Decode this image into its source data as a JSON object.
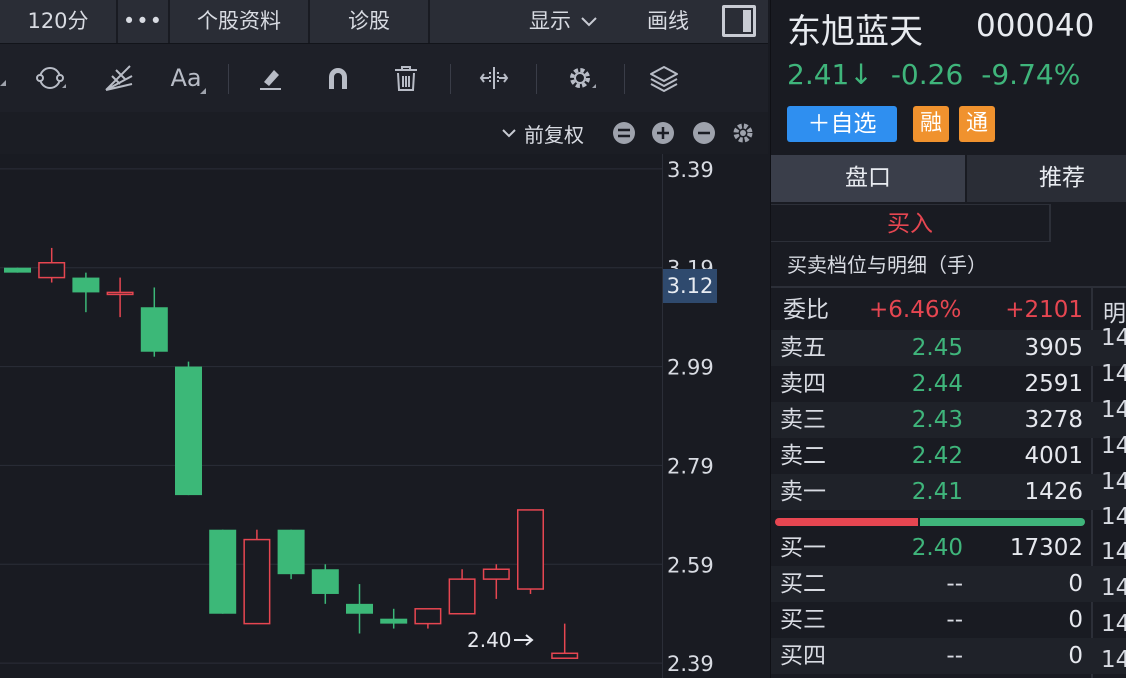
{
  "topbar": {
    "period": "120分",
    "more": "•••",
    "profile": "个股资料",
    "diagnose": "诊股",
    "display": "显示",
    "draw": "画线"
  },
  "toolbar": {
    "tools": [
      "cycle-tool",
      "fan-tool",
      "text-tool",
      "eraser-tool",
      "magnet-tool",
      "delete-tool",
      "range-tool",
      "settings-tool",
      "layers-tool"
    ],
    "text_tool_label": "Aa"
  },
  "chart_header": {
    "adjust": "前复权"
  },
  "chart": {
    "y_ticks": [
      "3.39",
      "3.19",
      "2.99",
      "2.79",
      "2.59",
      "2.39"
    ],
    "current_price_tag": "3.12",
    "low_label": "2.40",
    "colors": {
      "up": "#e64651",
      "down": "#3cb878",
      "grid": "#2b2e38",
      "tag": "#2f4a6e"
    }
  },
  "chart_data": {
    "type": "candlestick",
    "ylim": [
      2.36,
      3.42
    ],
    "candles": [
      {
        "open": 3.19,
        "close": 3.18,
        "high": 3.19,
        "low": 3.18
      },
      {
        "open": 3.17,
        "close": 3.2,
        "high": 3.23,
        "low": 3.16
      },
      {
        "open": 3.17,
        "close": 3.14,
        "high": 3.18,
        "low": 3.1
      },
      {
        "open": 3.14,
        "close": 3.14,
        "high": 3.17,
        "low": 3.09
      },
      {
        "open": 3.11,
        "close": 3.02,
        "high": 3.15,
        "low": 3.01
      },
      {
        "open": 2.99,
        "close": 2.73,
        "high": 3.0,
        "low": 2.73
      },
      {
        "open": 2.66,
        "close": 2.49,
        "high": 2.66,
        "low": 2.49
      },
      {
        "open": 2.47,
        "close": 2.64,
        "high": 2.66,
        "low": 2.47
      },
      {
        "open": 2.66,
        "close": 2.57,
        "high": 2.66,
        "low": 2.56
      },
      {
        "open": 2.58,
        "close": 2.53,
        "high": 2.59,
        "low": 2.51
      },
      {
        "open": 2.51,
        "close": 2.49,
        "high": 2.55,
        "low": 2.45
      },
      {
        "open": 2.48,
        "close": 2.47,
        "high": 2.5,
        "low": 2.46
      },
      {
        "open": 2.47,
        "close": 2.5,
        "high": 2.5,
        "low": 2.46
      },
      {
        "open": 2.49,
        "close": 2.56,
        "high": 2.58,
        "low": 2.49
      },
      {
        "open": 2.56,
        "close": 2.58,
        "high": 2.59,
        "low": 2.52
      },
      {
        "open": 2.54,
        "close": 2.7,
        "high": 2.7,
        "low": 2.53
      },
      {
        "open": 2.4,
        "close": 2.41,
        "high": 2.47,
        "low": 2.4
      }
    ]
  },
  "stock": {
    "name": "东旭蓝天",
    "code": "000040",
    "price": "2.41↓",
    "change": "-0.26",
    "change_pct": "-9.74%",
    "add_watch": "＋自选",
    "badge_margin": "融",
    "badge_connect": "通"
  },
  "tabs": {
    "orderbook": "盘口",
    "recommend": "推荐"
  },
  "trade": {
    "buy": "买入",
    "detail_title": "买卖档位与明细（手）",
    "commission_label": "委比",
    "commission_pct": "+6.46%",
    "commission_diff": "+2101",
    "tail_header": "明"
  },
  "orderbook": {
    "sells": [
      {
        "name": "卖五",
        "price": "2.45",
        "vol": "3905",
        "tail": "14"
      },
      {
        "name": "卖四",
        "price": "2.44",
        "vol": "2591",
        "tail": "14"
      },
      {
        "name": "卖三",
        "price": "2.43",
        "vol": "3278",
        "tail": "14"
      },
      {
        "name": "卖二",
        "price": "2.42",
        "vol": "4001",
        "tail": "14"
      },
      {
        "name": "卖一",
        "price": "2.41",
        "vol": "1426",
        "tail": "14"
      }
    ],
    "divider_tail": "14",
    "buys": [
      {
        "name": "买一",
        "price": "2.40",
        "vol": "17302",
        "tail": "14"
      },
      {
        "name": "买二",
        "price": "--",
        "vol": "0",
        "tail": "14"
      },
      {
        "name": "买三",
        "price": "--",
        "vol": "0",
        "tail": "14"
      },
      {
        "name": "买四",
        "price": "--",
        "vol": "0",
        "tail": "14"
      }
    ],
    "ratio_buy_fraction": 0.46
  }
}
